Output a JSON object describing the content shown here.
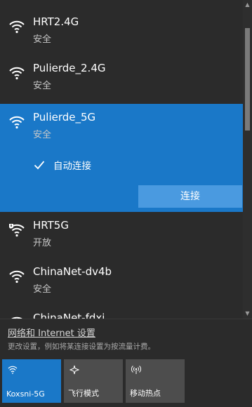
{
  "networks": [
    {
      "name": "HRT2.4G",
      "status": "安全"
    },
    {
      "name": "Pulierde_2.4G",
      "status": "安全"
    },
    {
      "name": "Pulierde_5G",
      "status": "安全"
    },
    {
      "name": "HRT5G",
      "status": "开放"
    },
    {
      "name": "ChinaNet-dv4b",
      "status": "安全"
    },
    {
      "name": "ChinaNet-fdxj",
      "status": ""
    }
  ],
  "selected": {
    "auto_connect_label": "自动连接",
    "connect_label": "连接"
  },
  "settings": {
    "link": "网络和 Internet 设置",
    "desc": "更改设置，例如将某连接设置为按流量计费。"
  },
  "quick_actions": [
    {
      "label": "Koxsni-5G",
      "icon": "wifi-icon",
      "active": true
    },
    {
      "label": "飞行模式",
      "icon": "airplane-icon",
      "active": false
    },
    {
      "label": "移动热点",
      "icon": "hotspot-icon",
      "active": false
    }
  ],
  "colors": {
    "accent": "#1a78c8",
    "background": "#2b2b2b",
    "tile_inactive": "#4d4d4d",
    "button": "#4a9ae0"
  }
}
